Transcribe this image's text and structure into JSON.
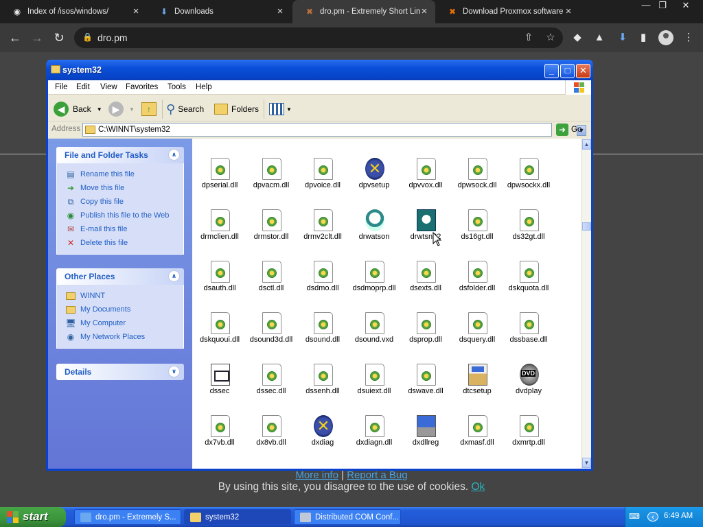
{
  "browser": {
    "tabs": [
      {
        "title": "Index of /isos/windows/",
        "icon": "github-icon"
      },
      {
        "title": "Downloads",
        "icon": "download-icon"
      },
      {
        "title": "dro.pm - Extremely Short Lin",
        "icon": "dro-icon"
      },
      {
        "title": "Download Proxmox software",
        "icon": "proxmox-icon"
      }
    ],
    "url": "dro.pm"
  },
  "page": {
    "link_more_info": "More info",
    "link_separator": "|",
    "link_report_bug": "Report a Bug",
    "cookie_text": "By using this site, you disagree to the use of cookies.",
    "cookie_ok": "Ok"
  },
  "explorer": {
    "title": "system32",
    "menu": [
      "File",
      "Edit",
      "View",
      "Favorites",
      "Tools",
      "Help"
    ],
    "toolbar": {
      "back": "Back",
      "search": "Search",
      "folders": "Folders"
    },
    "address_label": "Address",
    "address_value": "C:\\WINNT\\system32",
    "go_label": "Go",
    "file_tasks": {
      "title": "File and Folder Tasks",
      "items": [
        "Rename this file",
        "Move this file",
        "Copy this file",
        "Publish this file to the Web",
        "E-mail this file",
        "Delete this file"
      ]
    },
    "other_places": {
      "title": "Other Places",
      "items": [
        "WINNT",
        "My Documents",
        "My Computer",
        "My Network Places"
      ]
    },
    "details": {
      "title": "Details"
    },
    "files": [
      {
        "name": "dpserial.dll",
        "icon": "dll"
      },
      {
        "name": "dpvacm.dll",
        "icon": "dll"
      },
      {
        "name": "dpvoice.dll",
        "icon": "dll"
      },
      {
        "name": "dpvsetup",
        "icon": "x"
      },
      {
        "name": "dpvvox.dll",
        "icon": "dll"
      },
      {
        "name": "dpwsock.dll",
        "icon": "dll"
      },
      {
        "name": "dpwsockx.dll",
        "icon": "dll"
      },
      {
        "name": "drmclien.dll",
        "icon": "dll"
      },
      {
        "name": "drmstor.dll",
        "icon": "dll"
      },
      {
        "name": "drmv2clt.dll",
        "icon": "dll"
      },
      {
        "name": "drwatson",
        "icon": "dog"
      },
      {
        "name": "drwtsn32",
        "icon": "drwtsn"
      },
      {
        "name": "ds16gt.dll",
        "icon": "dll"
      },
      {
        "name": "ds32gt.dll",
        "icon": "dll"
      },
      {
        "name": "dsauth.dll",
        "icon": "dll"
      },
      {
        "name": "dsctl.dll",
        "icon": "dll"
      },
      {
        "name": "dsdmo.dll",
        "icon": "dll"
      },
      {
        "name": "dsdmoprp.dll",
        "icon": "dll"
      },
      {
        "name": "dsexts.dll",
        "icon": "dll"
      },
      {
        "name": "dsfolder.dll",
        "icon": "dll"
      },
      {
        "name": "dskquota.dll",
        "icon": "dll"
      },
      {
        "name": "dskquoui.dll",
        "icon": "dll"
      },
      {
        "name": "dsound3d.dll",
        "icon": "dll"
      },
      {
        "name": "dsound.dll",
        "icon": "dll"
      },
      {
        "name": "dsound.vxd",
        "icon": "dll"
      },
      {
        "name": "dsprop.dll",
        "icon": "dll"
      },
      {
        "name": "dsquery.dll",
        "icon": "dll"
      },
      {
        "name": "dssbase.dll",
        "icon": "dll"
      },
      {
        "name": "dssec",
        "icon": "doc"
      },
      {
        "name": "dssec.dll",
        "icon": "dll"
      },
      {
        "name": "dssenh.dll",
        "icon": "dll"
      },
      {
        "name": "dsuiext.dll",
        "icon": "dll"
      },
      {
        "name": "dswave.dll",
        "icon": "dll"
      },
      {
        "name": "dtcsetup",
        "icon": "setup"
      },
      {
        "name": "dvdplay",
        "icon": "dvd"
      },
      {
        "name": "dx7vb.dll",
        "icon": "dll"
      },
      {
        "name": "dx8vb.dll",
        "icon": "dll"
      },
      {
        "name": "dxdiag",
        "icon": "x"
      },
      {
        "name": "dxdiagn.dll",
        "icon": "dll"
      },
      {
        "name": "dxdllreg",
        "icon": "reg"
      },
      {
        "name": "dxmasf.dll",
        "icon": "dll"
      },
      {
        "name": "dxmrtp.dll",
        "icon": "dll"
      }
    ]
  },
  "taskbar": {
    "start_label": "start",
    "tasks": [
      {
        "label": "dro.pm - Extremely S...",
        "active": false
      },
      {
        "label": "system32",
        "active": true
      },
      {
        "label": "Distributed COM Conf...",
        "active": false
      }
    ],
    "clock": "6:49 AM"
  }
}
